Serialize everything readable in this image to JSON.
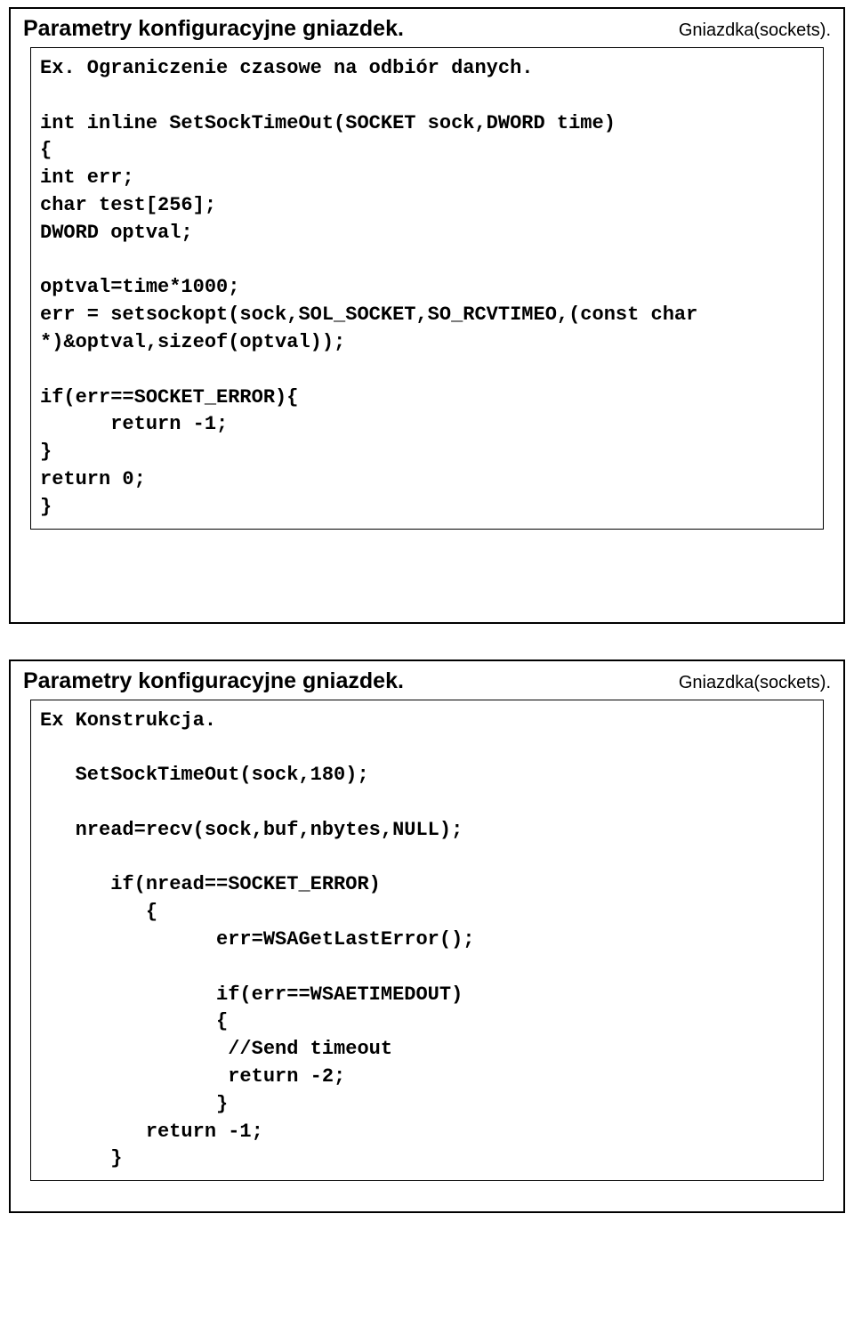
{
  "slide1": {
    "title": "Parametry konfiguracyjne gniazdek.",
    "subtitle": "Gniazdka(sockets).",
    "code": "Ex. Ograniczenie czasowe na odbiór danych.\n\nint inline SetSockTimeOut(SOCKET sock,DWORD time)\n{\nint err;\nchar test[256];\nDWORD optval;\n\noptval=time*1000;\nerr = setsockopt(sock,SOL_SOCKET,SO_RCVTIMEO,(const char\n*)&optval,sizeof(optval));\n\nif(err==SOCKET_ERROR){\n      return -1;\n}\nreturn 0;\n}"
  },
  "slide2": {
    "title": "Parametry konfiguracyjne gniazdek.",
    "subtitle": "Gniazdka(sockets).",
    "code": "Ex Konstrukcja.\n\n   SetSockTimeOut(sock,180);\n\n   nread=recv(sock,buf,nbytes,NULL);\n\n      if(nread==SOCKET_ERROR)\n         {\n               err=WSAGetLastError();\n\n               if(err==WSAETIMEDOUT)\n               {\n                //Send timeout\n                return -2;\n               }\n         return -1;\n      }"
  }
}
